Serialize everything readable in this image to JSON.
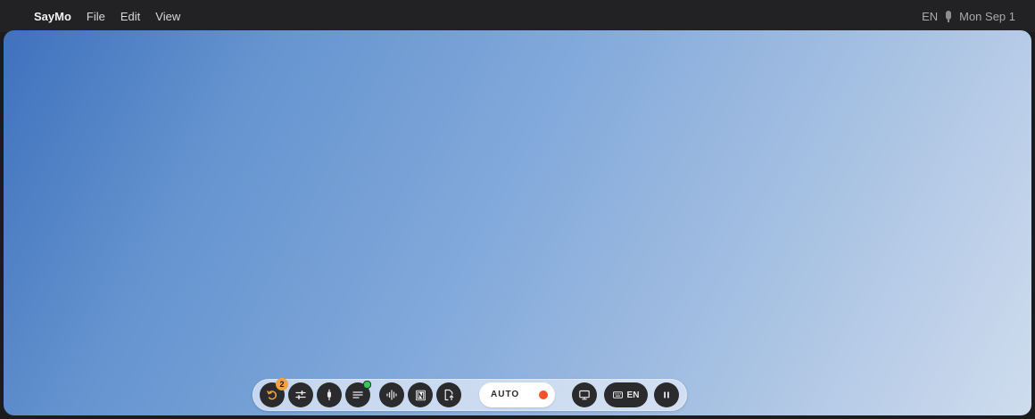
{
  "menubar": {
    "app_name": "SayMo",
    "menus": [
      "File",
      "Edit",
      "View"
    ],
    "language": "EN",
    "date": "Mon Sep 1"
  },
  "toolbar": {
    "history_badge_count": "2",
    "mode_label": "AUTO",
    "language_label": "EN",
    "status_indicator_color": "#34c759",
    "record_indicator_color": "#f4512c",
    "badge_color": "#f5a13c"
  }
}
